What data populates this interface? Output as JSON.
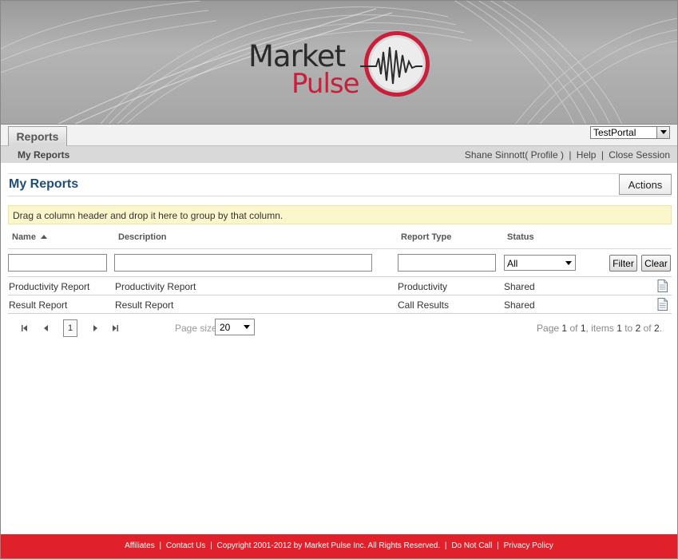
{
  "brand": {
    "logo_line1": "Market",
    "logo_line2": "Pulse",
    "accent_color": "#e0202a",
    "title_color": "#1f4e79"
  },
  "tabs": [
    {
      "label": "Reports",
      "selected": true
    }
  ],
  "portal_select": {
    "value": "TestPortal"
  },
  "subnav": {
    "current": "My Reports",
    "user": "Shane Sinnott",
    "profile": "( Profile )",
    "help": "Help",
    "close_session": "Close Session",
    "separator": "|"
  },
  "page": {
    "title": "My Reports",
    "actions_label": "Actions"
  },
  "grid": {
    "group_hint": "Drag a column header and drop it here to group by that column.",
    "columns": [
      {
        "label": "Name",
        "sorted": "ascending"
      },
      {
        "label": "Description"
      },
      {
        "label": "Report Type"
      },
      {
        "label": "Status"
      }
    ],
    "status_filter_value": "All",
    "filter_button": "Filter",
    "clear_button": "Clear",
    "rows": [
      {
        "name": "Productivity Report",
        "description": "Productivity Report",
        "type": "Productivity",
        "status": "Shared",
        "icon": "document-icon"
      },
      {
        "name": "Result Report",
        "description": "Result Report",
        "type": "Call Results",
        "status": "Shared",
        "icon": "document-icon"
      }
    ]
  },
  "pager": {
    "current_page": "1",
    "page_size_label": "Page size",
    "page_size": "20",
    "summary": {
      "page_word": "Page",
      "page": "1",
      "of_word": "of",
      "pages": "1",
      "items_word": ", items",
      "from": "1",
      "to_word": "to",
      "to": "2",
      "of_word2": "of",
      "total": "2",
      "end": "."
    }
  },
  "footer": {
    "links": [
      "Affiliates",
      "Contact Us"
    ],
    "copyright": "Copyright 2001-2012 by Market Pulse Inc. All Rights Reserved.",
    "links2": [
      "Do Not Call",
      "Privacy Policy"
    ],
    "separator": "|"
  }
}
